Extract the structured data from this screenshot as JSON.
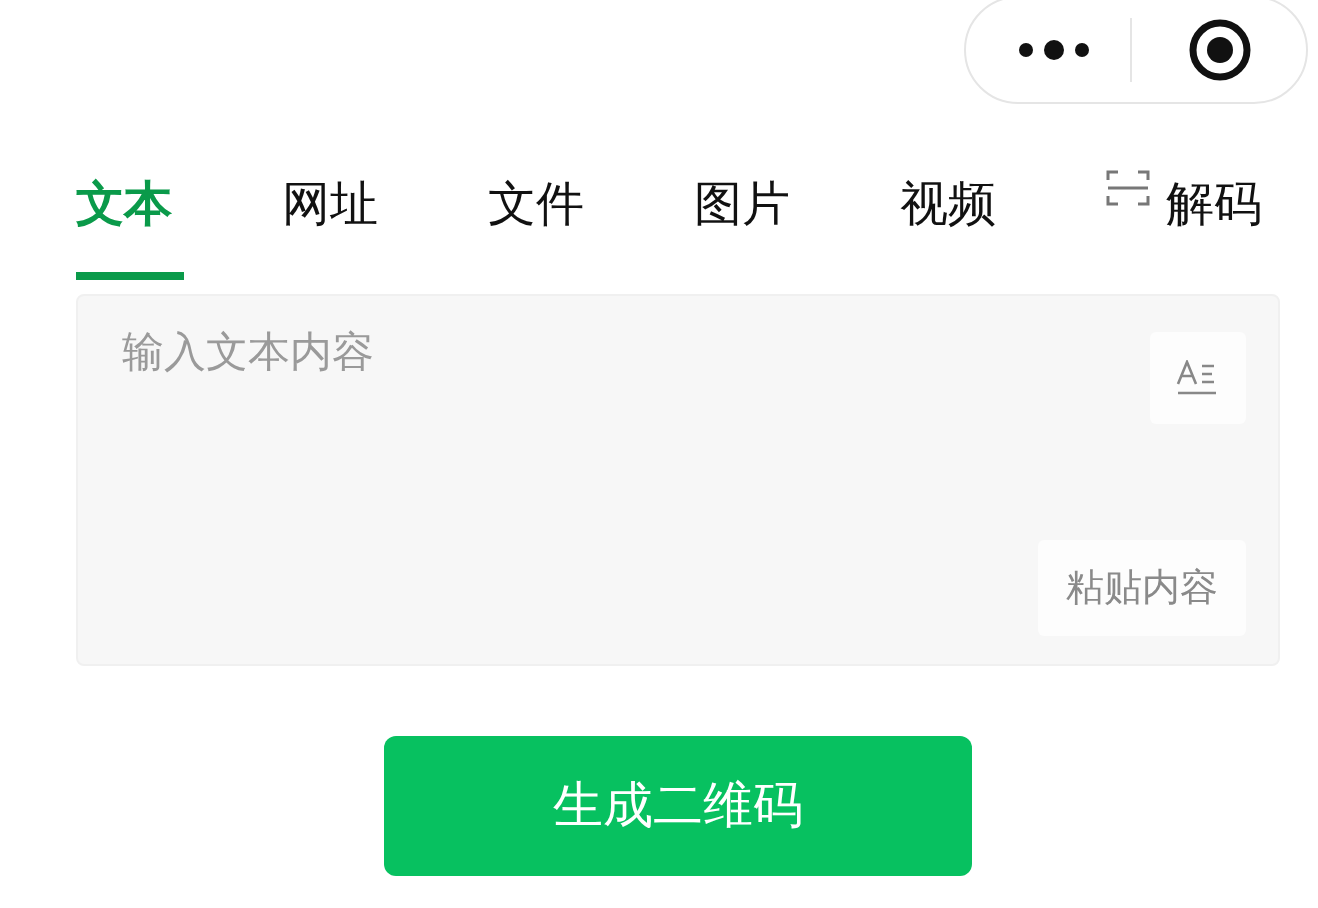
{
  "tabs": [
    {
      "label": "文本",
      "selected": true
    },
    {
      "label": "网址",
      "selected": false
    },
    {
      "label": "文件",
      "selected": false
    },
    {
      "label": "图片",
      "selected": false
    },
    {
      "label": "视频",
      "selected": false
    },
    {
      "label": "解码",
      "selected": false,
      "kind": "scan"
    }
  ],
  "text_input": {
    "placeholder": "输入文本内容"
  },
  "paste_button": "粘贴内容",
  "generate_button": "生成二维码"
}
